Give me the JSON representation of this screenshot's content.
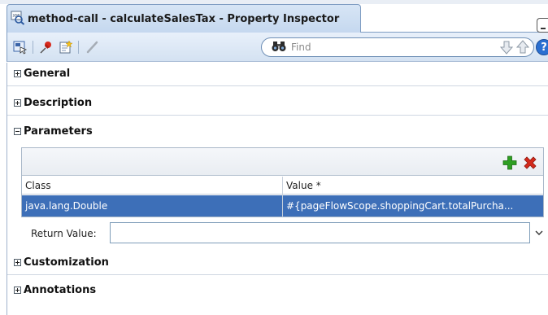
{
  "window": {
    "title": "method-call - calculateSalesTax - Property Inspector"
  },
  "toolbar": {
    "find_placeholder": "Find",
    "help_label": "?"
  },
  "sections": {
    "general": "General",
    "description": "Description",
    "parameters": "Parameters",
    "customization": "Customization",
    "annotations": "Annotations"
  },
  "parameters_table": {
    "columns": [
      "Class",
      "Value *"
    ],
    "rows": [
      {
        "class": "java.lang.Double",
        "value": "#{pageFlowScope.shoppingCart.totalPurcha..."
      }
    ]
  },
  "return_value": {
    "label": "Return Value:",
    "value": ""
  },
  "colors": {
    "accent": "#3d6fb8",
    "tab_bg": "#c5d8ef",
    "add_green": "#2e9e22",
    "delete_red": "#d42a1c"
  }
}
